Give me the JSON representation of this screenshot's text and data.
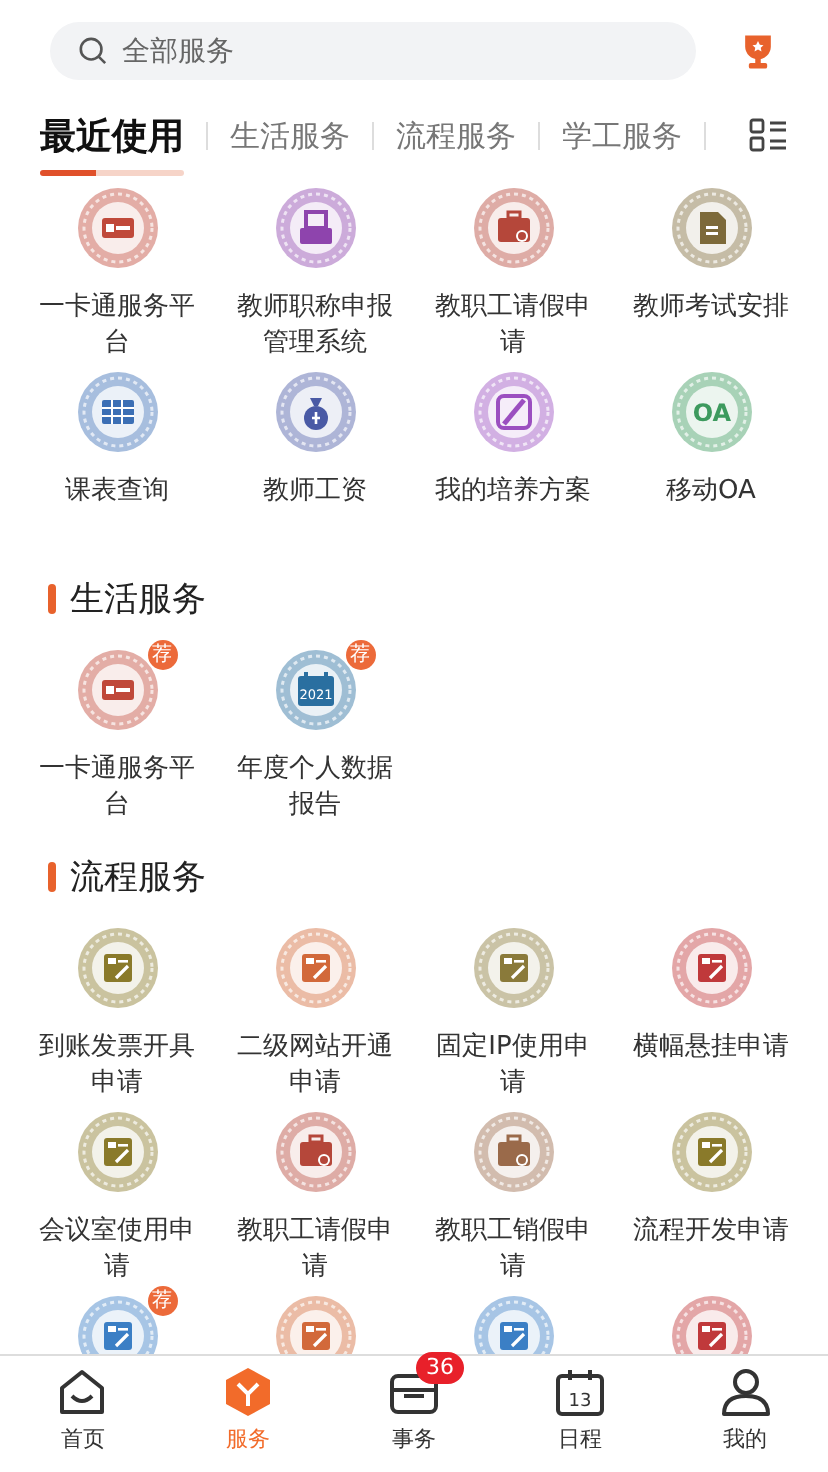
{
  "search": {
    "placeholder": "全部服务"
  },
  "tabs": [
    {
      "label": "最近使用",
      "selected": true
    },
    {
      "label": "生活服务",
      "selected": false
    },
    {
      "label": "流程服务",
      "selected": false
    },
    {
      "label": "学工服务",
      "selected": false
    }
  ],
  "sections": [
    {
      "items": [
        {
          "label": "一卡通服务平台",
          "kind": "card",
          "color": "#c0493a"
        },
        {
          "label": "教师职称申报管理系统",
          "kind": "printer",
          "color": "#8e44ad"
        },
        {
          "label": "教职工请假申请",
          "kind": "briefcase",
          "color": "#b5473a"
        },
        {
          "label": "教师考试安排",
          "kind": "doc",
          "color": "#7d6a3a"
        },
        {
          "label": "课表查询",
          "kind": "grid",
          "color": "#3b6fb5"
        },
        {
          "label": "教师工资",
          "kind": "money",
          "color": "#4a5aa5"
        },
        {
          "label": "我的培养方案",
          "kind": "slash",
          "color": "#9b4fc0"
        },
        {
          "label": "移动OA",
          "kind": "text",
          "glyph_text": "OA",
          "color": "#3d9a5e"
        }
      ]
    },
    {
      "title": "生活服务",
      "items": [
        {
          "label": "一卡通服务平台",
          "kind": "card",
          "color": "#c0493a",
          "badge": "荐"
        },
        {
          "label": "年度个人数据报告",
          "kind": "calendar",
          "glyph_text": "2021",
          "color": "#2a6fa0",
          "badge": "荐"
        }
      ]
    },
    {
      "title": "流程服务",
      "items": [
        {
          "label": "到账发票开具申请",
          "kind": "form",
          "color": "#8a7a2a"
        },
        {
          "label": "二级网站开通申请",
          "kind": "form",
          "color": "#d2693a"
        },
        {
          "label": "固定IP使用申请",
          "kind": "form",
          "color": "#8a7a3a"
        },
        {
          "label": "横幅悬挂申请",
          "kind": "form",
          "color": "#c0393b"
        },
        {
          "label": "会议室使用申请",
          "kind": "form",
          "color": "#8a7a2a"
        },
        {
          "label": "教职工请假申请",
          "kind": "briefcase",
          "color": "#b5473a"
        },
        {
          "label": "教职工销假申请",
          "kind": "briefcase",
          "color": "#9a6a4a"
        },
        {
          "label": "流程开发申请",
          "kind": "form",
          "color": "#8a7a2a"
        },
        {
          "kind": "form",
          "color": "#3b7fc5",
          "badge": "荐"
        },
        {
          "kind": "form",
          "color": "#d2693a"
        },
        {
          "kind": "form",
          "color": "#3b7fc5"
        },
        {
          "kind": "form",
          "color": "#c0393b"
        }
      ]
    }
  ],
  "nav": [
    {
      "label": "首页",
      "kind": "home",
      "selected": false
    },
    {
      "label": "服务",
      "kind": "service",
      "selected": true
    },
    {
      "label": "事务",
      "kind": "tasks",
      "selected": false,
      "badge": "36"
    },
    {
      "label": "日程",
      "kind": "calendar",
      "glyph_text": "13",
      "selected": false
    },
    {
      "label": "我的",
      "kind": "user",
      "selected": false
    }
  ]
}
